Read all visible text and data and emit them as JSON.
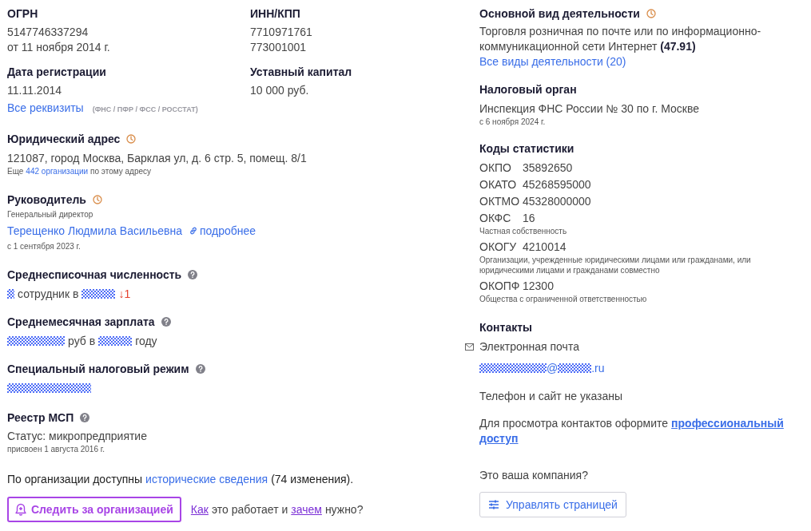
{
  "left_top": [
    {
      "label": "ОГРН",
      "lines": [
        "5147746337294",
        "от 11 ноября 2014 г."
      ]
    },
    {
      "label": "ИНН/КПП",
      "lines": [
        "7710971761",
        "773001001"
      ]
    },
    {
      "label": "Дата регистрации",
      "lines": [
        "11.11.2014"
      ]
    },
    {
      "label": "Уставный капитал",
      "lines": [
        "10 000 руб."
      ]
    }
  ],
  "requisites": {
    "link": "Все реквизиты",
    "note": "(ФНС / ПФР / ФСС / РОССТАТ)"
  },
  "legal_address": {
    "label": "Юридический адрес",
    "kind": "history",
    "text": "121087, город Москва, Барклая ул, д. 6 стр. 5, помещ. 8/1",
    "note_before": "Еще",
    "note_link": "442 организации",
    "note_after": "по этому адресу"
  },
  "director": {
    "label": "Руководитель",
    "kind": "history",
    "position": "Генеральный директор",
    "name": "Терещенко Людмила Васильевна",
    "more": "подробнее",
    "since": "с 1 сентября 2023 г."
  },
  "metrics": [
    {
      "label": "Среднесписочная численность",
      "kind": "help",
      "parts": [
        {
          "kind": "masked"
        },
        {
          "kind": "text",
          "text": "сотрудник в"
        },
        {
          "kind": "masked"
        },
        {
          "kind": "change",
          "text": "↓1"
        }
      ]
    },
    {
      "label": "Среднемесячная зарплата",
      "kind": "help",
      "parts": [
        {
          "kind": "masked"
        },
        {
          "kind": "text",
          "text": "руб в"
        },
        {
          "kind": "masked"
        },
        {
          "kind": "text",
          "text": "году"
        }
      ]
    },
    {
      "label": "Специальный налоговый режим",
      "kind": "help",
      "parts": [
        {
          "kind": "masked"
        }
      ]
    }
  ],
  "msp": {
    "label": "Реестр МСП",
    "kind": "help",
    "status": "Статус: микропредприятие",
    "since": "присвоен 1 августа 2016 г."
  },
  "history": {
    "before": "По организации доступны",
    "link": "исторические сведения",
    "after": "(74 изменения)."
  },
  "follow": {
    "button": "Следить за организацией",
    "parts": [
      {
        "kind": "link",
        "text": "Как"
      },
      {
        "kind": "text",
        "text": "это работает и"
      },
      {
        "kind": "link",
        "text": "зачем"
      },
      {
        "kind": "text",
        "text": "нужно?"
      }
    ]
  },
  "activity": {
    "label": "Основной вид деятельности",
    "kind": "history",
    "text": "Торговля розничная по почте или по информационно-коммуникационной сети Интернет **(47.91)**",
    "link": "Все виды деятельности (20)"
  },
  "tax_authority": {
    "label": "Налоговый орган",
    "text": "Инспекция ФНС России № 30 по г. Москве",
    "since": "с 6 ноября 2024 г."
  },
  "stat_codes": {
    "label": "Коды статистики",
    "codes": [
      {
        "code": "ОКПО",
        "value": "35892650"
      },
      {
        "code": "ОКАТО",
        "value": "45268595000"
      },
      {
        "code": "ОКТМО",
        "value": "45328000000"
      },
      {
        "code": "ОКФС",
        "value": "16",
        "note": "Частная собственность"
      },
      {
        "code": "ОКОГУ",
        "value": "4210014",
        "note": "Организации, учрежденные юридическими лицами или гражданами, или юридическими лицами и гражданами совместно"
      },
      {
        "code": "ОКОПФ",
        "value": "12300",
        "note": "Общества с ограниченной ответственностью"
      }
    ]
  },
  "contacts": {
    "label": "Контакты",
    "email_label": "Электронная почта",
    "email_parts": [
      {
        "kind": "masked"
      },
      {
        "kind": "text",
        "text": "@"
      },
      {
        "kind": "masked"
      },
      {
        "kind": "text",
        "text": ".ru"
      }
    ],
    "no_phone": "Телефон и сайт не указаны",
    "pro_before": "Для просмотра контактов оформите",
    "pro_link": [
      "профессиональный",
      "доступ"
    ]
  },
  "own_company": {
    "question": "Это ваша компания?",
    "button": "Управлять страницей"
  }
}
